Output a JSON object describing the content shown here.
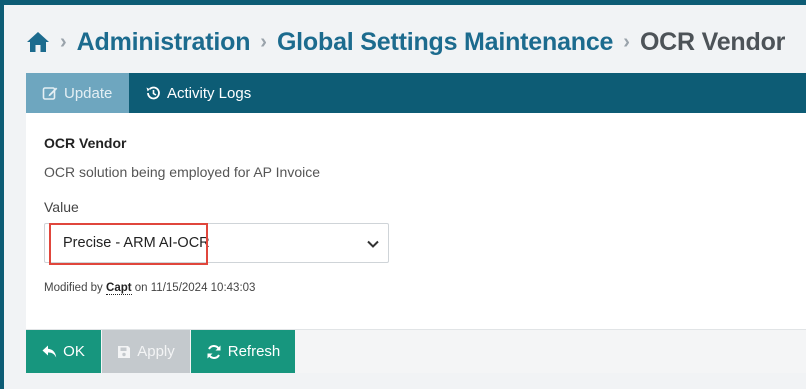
{
  "breadcrumb": {
    "home_icon": "home-icon",
    "items": [
      "Administration",
      "Global Settings Maintenance"
    ],
    "current": "OCR Vendor",
    "separator": "›"
  },
  "tabs": [
    {
      "label": "Update",
      "icon": "edit-icon",
      "active": true
    },
    {
      "label": "Activity Logs",
      "icon": "history-icon",
      "active": false
    }
  ],
  "field": {
    "title": "OCR Vendor",
    "description": "OCR solution being employed for AP Invoice",
    "label": "Value",
    "selected_value": "Precise - ARM AI-OCR"
  },
  "modified": {
    "prefix": "Modified by",
    "user": "Capt",
    "suffix": "on 11/15/2024 10:43:03"
  },
  "actions": {
    "ok": "OK",
    "apply": "Apply",
    "refresh": "Refresh"
  },
  "colors": {
    "primary": "#0d5c75",
    "link": "#1c6b8e",
    "success": "#17967e",
    "disabled": "#c4c9cd",
    "highlight": "#e0463c"
  }
}
